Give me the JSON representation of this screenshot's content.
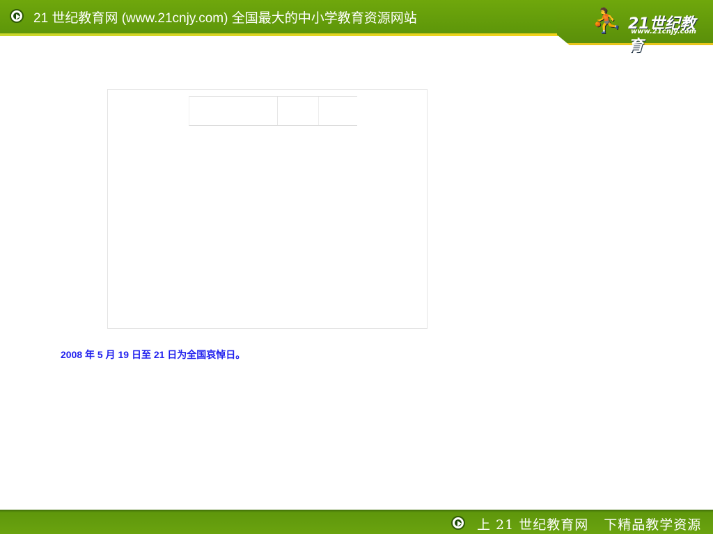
{
  "header": {
    "title": "21 世纪教育网 (www.21cnjy.com)  全国最大的中小学教育资源网站",
    "logo_text": "21世纪教育",
    "logo_url": "www.21cnjy.com"
  },
  "content": {
    "note": "2008 年 5 月 19 日至 21 日为全国哀悼日。"
  },
  "footer": {
    "prev_label": "上 21 世纪教育网",
    "next_label": "下精品教学资源"
  }
}
